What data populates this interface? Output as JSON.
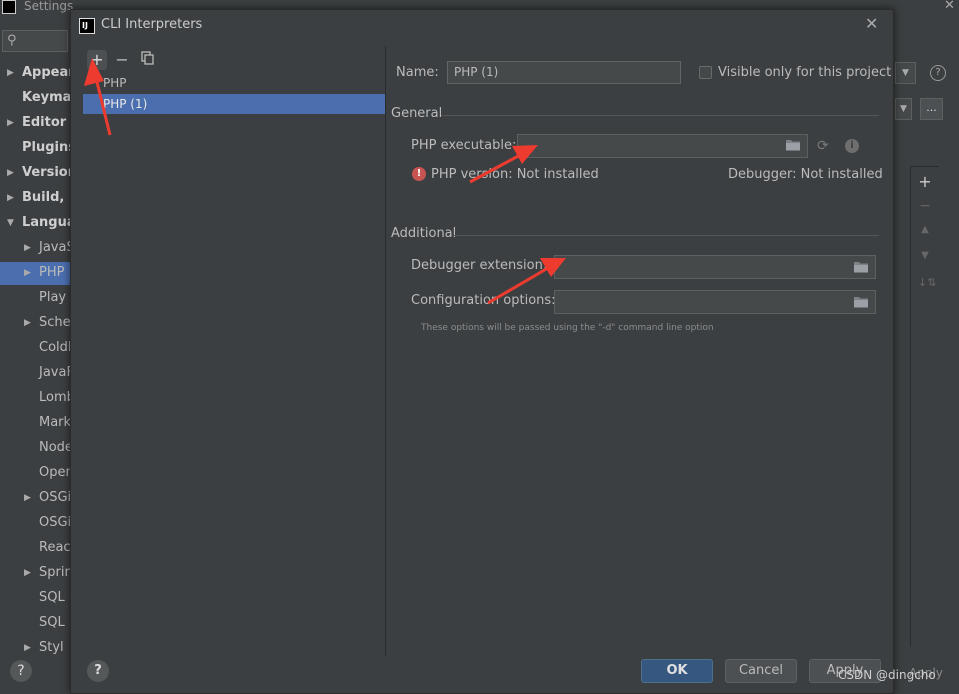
{
  "background_window": {
    "title": "Settings",
    "tree": [
      {
        "label": "Appeara",
        "bold": true,
        "arrow": true
      },
      {
        "label": "Keymap",
        "bold": true,
        "arrow": false
      },
      {
        "label": "Editor",
        "bold": true,
        "arrow": true
      },
      {
        "label": "Plugins",
        "bold": true,
        "arrow": false
      },
      {
        "label": "Version",
        "bold": true,
        "arrow": true
      },
      {
        "label": "Build, E",
        "bold": true,
        "arrow": true
      },
      {
        "label": "Languag",
        "bold": true,
        "arrow": "down"
      },
      {
        "label": "JavaS",
        "bold": false,
        "arrow": true
      },
      {
        "label": "PHP",
        "bold": false,
        "arrow": true
      },
      {
        "label": "Play C",
        "bold": false,
        "arrow": false
      },
      {
        "label": "Schem",
        "bold": false,
        "arrow": true
      },
      {
        "label": "ColdF",
        "bold": false,
        "arrow": false
      },
      {
        "label": "JavaF",
        "bold": false,
        "arrow": false
      },
      {
        "label": "Lomb",
        "bold": false,
        "arrow": false
      },
      {
        "label": "Mark",
        "bold": false,
        "arrow": false
      },
      {
        "label": "Node",
        "bold": false,
        "arrow": false
      },
      {
        "label": "Open",
        "bold": false,
        "arrow": false
      },
      {
        "label": "OSGi",
        "bold": false,
        "arrow": true
      },
      {
        "label": "OSGi",
        "bold": false,
        "arrow": false
      },
      {
        "label": "React",
        "bold": false,
        "arrow": false
      },
      {
        "label": "Sprin",
        "bold": false,
        "arrow": true
      },
      {
        "label": "SQL D",
        "bold": false,
        "arrow": false
      },
      {
        "label": "SQL F",
        "bold": false,
        "arrow": false
      },
      {
        "label": "Styl",
        "bold": false,
        "arrow": true
      }
    ],
    "apply_label": "Apply"
  },
  "dialog": {
    "title": "CLI Interpreters",
    "interpreters": [
      "PHP",
      "PHP (1)"
    ],
    "name_label": "Name:",
    "name_value": "PHP (1)",
    "visible_only_label": "Visible only for this project",
    "general_title": "General",
    "php_executable_label": "PHP executable:",
    "php_version_text": "PHP version: Not installed",
    "debugger_text": "Debugger: Not installed",
    "additional_title": "Additional",
    "debugger_extension_label": "Debugger extension:",
    "configuration_options_label": "Configuration options:",
    "config_hint": "These options will be passed using the \"-d\" command line option",
    "ok_label": "OK",
    "cancel_label": "Cancel",
    "apply_label": "Apply"
  },
  "watermark": "CSDN @dingcho",
  "colors": {
    "background": "#3c3f41",
    "selection": "#4b6eaf",
    "ok_button": "#365880",
    "error": "#c75450",
    "annotation_arrow": "#ee3b2f"
  }
}
